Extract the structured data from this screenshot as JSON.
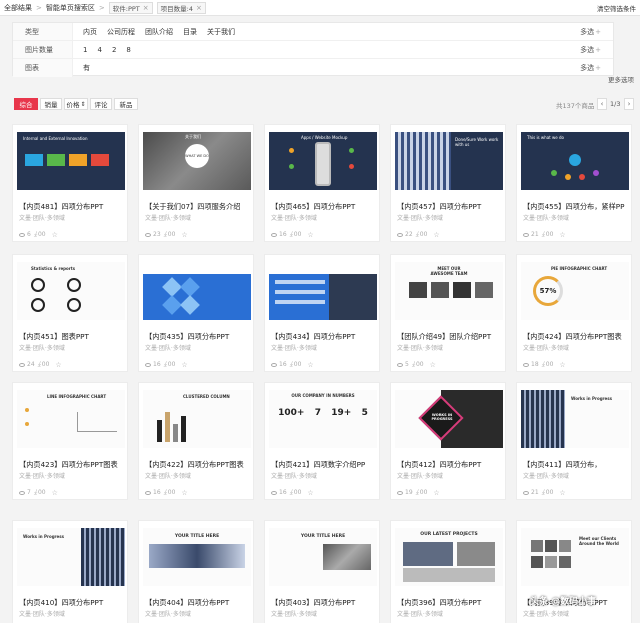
{
  "breadcrumb": {
    "root": "全部结果",
    "section": "智能单页搜索区",
    "sep": ">"
  },
  "chips": [
    {
      "label": "软件:PPT",
      "x": "×"
    },
    {
      "label": "项目数量:4",
      "x": "×"
    }
  ],
  "clear_filters": "清空筛选条件",
  "filters": [
    {
      "label": "类型",
      "options": [
        "内页",
        "公司历程",
        "团队介绍",
        "目录",
        "关于我们"
      ],
      "multi": "多选",
      "plus": "+"
    },
    {
      "label": "图片数量",
      "options": [
        "1",
        "4",
        "2",
        "8"
      ],
      "multi": "多选",
      "plus": "+"
    },
    {
      "label": "图表",
      "options": [
        "有"
      ],
      "multi": "多选",
      "plus": "+"
    }
  ],
  "more_options": "更多选项",
  "sort": {
    "items": [
      "综合",
      "销量",
      "价格",
      "评论",
      "新品"
    ],
    "price_arrow": "⇕"
  },
  "results_total": "共137个商品",
  "pager": {
    "page": "1/3",
    "prev": "‹",
    "next": "›"
  },
  "card_sub": "文墨·团队·多领域",
  "cards": [
    {
      "title": "【内页481】四项分布PPT",
      "views": "6",
      "downloads": "00"
    },
    {
      "title": "【关于我们07】四项服务介绍",
      "views": "23",
      "downloads": "00"
    },
    {
      "title": "【内页465】四项分布PPT",
      "views": "16",
      "downloads": "00"
    },
    {
      "title": "【内页457】四项分布PPT",
      "views": "22",
      "downloads": "00"
    },
    {
      "title": "【内页455】四项分布，紧样PP",
      "views": "21",
      "downloads": "00"
    },
    {
      "title": "【内页451】图表PPT",
      "views": "24",
      "downloads": "00"
    },
    {
      "title": "【内页435】四项分布PPT",
      "views": "16",
      "downloads": "00"
    },
    {
      "title": "【内页434】四项分布PPT",
      "views": "16",
      "downloads": "00"
    },
    {
      "title": "【团队介绍49】团队介绍PPT",
      "views": "5",
      "downloads": "00"
    },
    {
      "title": "【内页424】四项分布PPT图表",
      "views": "18",
      "downloads": "00"
    },
    {
      "title": "【内页423】四项分布PPT图表",
      "views": "7",
      "downloads": "00"
    },
    {
      "title": "【内页422】四项分布PPT图表",
      "views": "16",
      "downloads": "00"
    },
    {
      "title": "【内页421】四项数字介绍PP",
      "views": "16",
      "downloads": "00"
    },
    {
      "title": "【内页412】四项分布PPT",
      "views": "19",
      "downloads": "00"
    },
    {
      "title": "【内页411】四项分布，",
      "views": "21",
      "downloads": "00"
    },
    {
      "title": "【内页410】四项分布PPT",
      "views": "",
      "downloads": ""
    },
    {
      "title": "【内页404】四项分布PPT",
      "views": "",
      "downloads": ""
    },
    {
      "title": "【内页403】四项分布PPT",
      "views": "",
      "downloads": ""
    },
    {
      "title": "【内页396】四项分布PPT",
      "views": "",
      "downloads": ""
    },
    {
      "title": "【内页395】四项分布PPT",
      "views": "",
      "downloads": ""
    }
  ],
  "thumb_text": {
    "c1": "Internal and External Innovation",
    "c2_title": "关于我们",
    "c2_center": "WHAT WE DO",
    "c3": "Apps / Website Mockup",
    "c4": "Done/Sure Work work with us",
    "c5": "This is what we do",
    "c6": "Statistics & reports",
    "c9": "MEET OUR AWESOME TEAM",
    "c10_title": "PIE INFOGRAPHIC CHART",
    "c10_pct": "57%",
    "c11": "LINE INFOGRAPHIC CHART",
    "c12": "CLUSTERED COLUMN",
    "c13_title": "OUR COMPANY IN NUMBERS",
    "c13_nums": [
      "100+",
      "7",
      "19+",
      "5"
    ],
    "c14": "WORKS IN PROGRESS",
    "c15": "Works in Progress",
    "c16": "Works in Progress",
    "c17": "YOUR TITLE HERE",
    "c18": "YOUR TITLE HERE",
    "c19": "OUR LATEST PROJECTS",
    "c20": "Meet our Clients Around the World"
  },
  "watermark": "头条 @数码小事",
  "colors": {
    "accent": "#e8364b"
  }
}
